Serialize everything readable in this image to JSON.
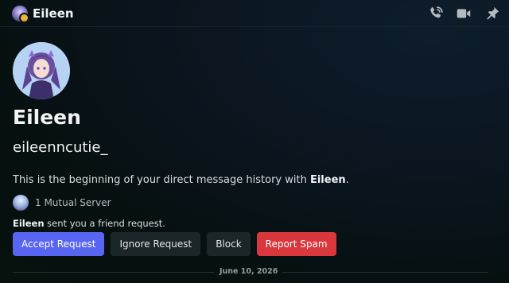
{
  "header": {
    "title": "Eileen",
    "avatar": "user-avatar",
    "status_color": "#f0b232",
    "icons": [
      "voice-call-icon",
      "video-call-icon",
      "pin-icon"
    ]
  },
  "profile": {
    "display_name": "Eileen",
    "username": "eileenncutie_",
    "beginning_prefix": "This is the beginning of your direct message history with ",
    "beginning_name": "Eileen",
    "beginning_suffix": ".",
    "mutual_servers": "1 Mutual Server"
  },
  "friend_request": {
    "name": "Eileen",
    "text": " sent you a friend request.",
    "accept_label": "Accept Request",
    "ignore_label": "Ignore Request",
    "block_label": "Block",
    "report_label": "Report Spam"
  },
  "divider": {
    "date": "June 10, 2026"
  },
  "colors": {
    "accent": "#5865f2",
    "danger": "#da373c",
    "secondary_button": "#1b2629"
  }
}
